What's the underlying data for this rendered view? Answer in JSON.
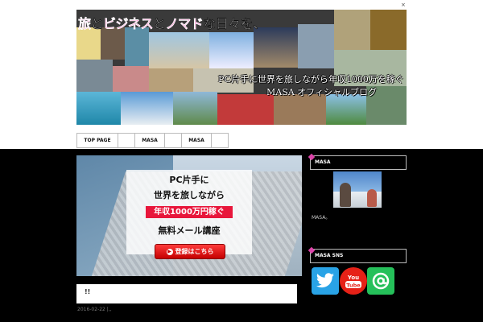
{
  "header": {
    "close_label": "×",
    "banner": {
      "title_parts": [
        {
          "text": "旅",
          "style": "p"
        },
        {
          "text": "と",
          "style": "w"
        },
        {
          "text": "ビジネス",
          "style": "p"
        },
        {
          "text": "と",
          "style": "w"
        },
        {
          "text": "ノマド",
          "style": "p"
        },
        {
          "text": "な日々を、",
          "style": "w"
        }
      ],
      "subtitle": "PC片手に世界を旅しながら年収1000万を稼ぐ",
      "subtitle2": "MASA オフィシャルブログ"
    }
  },
  "nav": {
    "items": [
      {
        "label": "TOP PAGE"
      },
      {
        "label": ""
      },
      {
        "label": "MASA"
      },
      {
        "label": ""
      },
      {
        "label": "MASA"
      },
      {
        "label": ""
      }
    ]
  },
  "hero": {
    "line1": "PC片手に",
    "line2": "世界を旅しながら",
    "highlight": "年収1000万円稼ぐ",
    "line4": "無料メール講座",
    "button_label": "登録はこちら"
  },
  "post": {
    "title": "!!",
    "date": "2016-02-22 |,,"
  },
  "sidebar": {
    "profile_heading": "MASA",
    "profile_caption": "MASA。",
    "sns_heading": "MASA SNS",
    "sns": [
      {
        "name": "twitter-icon",
        "color": "#29a3e6"
      },
      {
        "name": "youtube-icon",
        "color": "#e62117"
      },
      {
        "name": "line-at-icon",
        "color": "#25c05a"
      }
    ]
  }
}
